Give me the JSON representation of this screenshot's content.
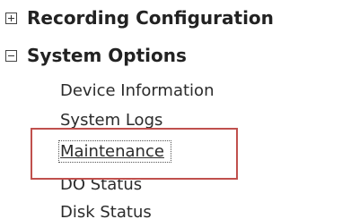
{
  "tree": {
    "nodes": [
      {
        "label": "Recording Configuration",
        "expanded": false,
        "toggle_icon": "plus-box"
      },
      {
        "label": "System Options",
        "expanded": true,
        "toggle_icon": "minus-box"
      }
    ],
    "system_options_children": [
      "Device Information",
      "System Logs",
      "Maintenance",
      "DO Status",
      "Disk Status"
    ]
  },
  "focused_item": "Maintenance",
  "annotation": {
    "color": "#c0504d"
  }
}
